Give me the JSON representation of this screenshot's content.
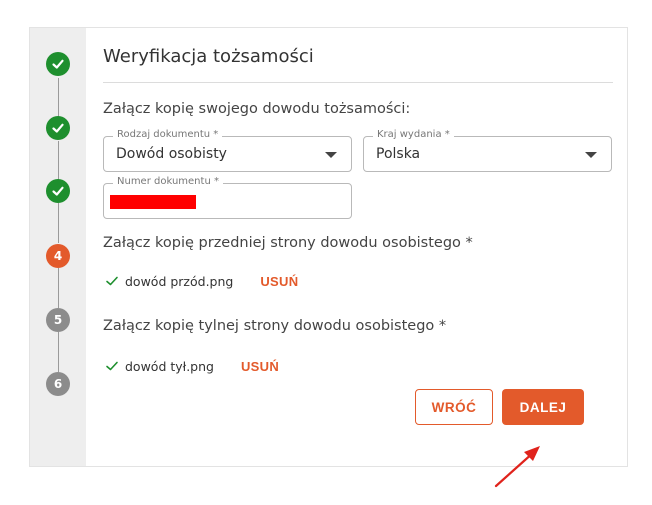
{
  "stepper": {
    "steps": [
      {
        "state": "done",
        "label": ""
      },
      {
        "state": "done",
        "label": ""
      },
      {
        "state": "done",
        "label": ""
      },
      {
        "state": "current",
        "label": "4"
      },
      {
        "state": "pending",
        "label": "5"
      },
      {
        "state": "pending",
        "label": "6"
      }
    ]
  },
  "form": {
    "title": "Weryfikacja tożsamości",
    "subtitle": "Załącz kopię swojego dowodu tożsamości:",
    "document_type": {
      "label": "Rodzaj dokumentu *",
      "value": "Dowód osobisty"
    },
    "issuing_country": {
      "label": "Kraj wydania *",
      "value": "Polska"
    },
    "document_number": {
      "label": "Numer dokumentu *"
    },
    "front": {
      "label": "Załącz kopię przedniej strony dowodu osobistego *",
      "file": "dowód przód.png",
      "remove": "USUŃ"
    },
    "back": {
      "label": "Załącz kopię tylnej strony dowodu osobistego *",
      "file": "dowód tył.png",
      "remove": "USUŃ"
    }
  },
  "actions": {
    "back_label": "WRÓĆ",
    "next_label": "DALEJ"
  },
  "colors": {
    "accent": "#e35a2b",
    "success": "#1e8f2e",
    "pending": "#8c8c8c",
    "redaction": "#ff0000"
  },
  "icons": {
    "done_step": "check-icon",
    "uploaded": "check-icon",
    "select": "caret-down-icon",
    "annotation": "arrow-icon"
  }
}
